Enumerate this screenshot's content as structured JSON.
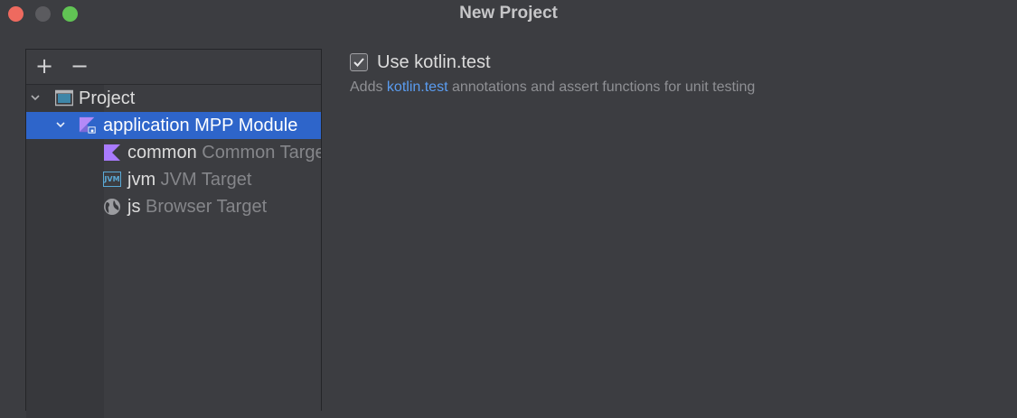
{
  "window": {
    "title": "New Project"
  },
  "toolbar": {
    "add_label": "+",
    "remove_label": "−"
  },
  "tree": {
    "project": {
      "label": "Project"
    },
    "module": {
      "label": "application MPP Module"
    },
    "common": {
      "name": "common",
      "type": "Common Target"
    },
    "jvm": {
      "name": "jvm",
      "type": "JVM Target",
      "icon_text": "JVM"
    },
    "js": {
      "name": "js",
      "type": "Browser Target"
    }
  },
  "options": {
    "use_kotlin_test": {
      "checked": true,
      "label": "Use kotlin.test",
      "desc_prefix": "Adds ",
      "desc_link": "kotlin.test",
      "desc_suffix": " annotations and assert functions for unit testing"
    }
  },
  "colors": {
    "selection": "#2e65ca",
    "link": "#5a9cf0",
    "kotlin_purple": "#a97bff"
  }
}
